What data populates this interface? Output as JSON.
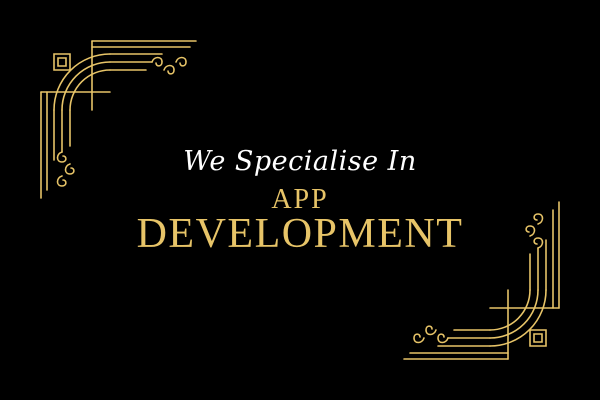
{
  "colors": {
    "background": "#000000",
    "gold": "#e7c468",
    "tagline": "#ffffff"
  },
  "text": {
    "tagline": "We Specialise In",
    "line1": "APP",
    "line2": "DEVELOPMENT"
  },
  "ornaments": {
    "top_left": "art-deco-corner-icon",
    "bottom_right": "art-deco-corner-icon"
  }
}
